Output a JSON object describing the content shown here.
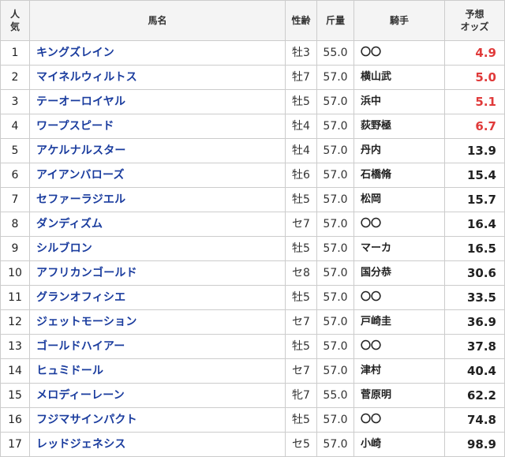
{
  "headers": {
    "rank_line1": "人",
    "rank_line2": "気",
    "name": "馬名",
    "sex_age": "性齢",
    "weight": "斤量",
    "jockey": "騎手",
    "odds_line1": "予想",
    "odds_line2": "オッズ"
  },
  "colors": {
    "horse_name": "#1a3c9e",
    "favorite_odds": "#e03a3a",
    "header_bg": "#f4f4f4"
  },
  "rows": [
    {
      "rank": "1",
      "name": "キングズレイン",
      "sex_age": "牡3",
      "weight": "55.0",
      "jockey": "〇〇",
      "odds": "4.9",
      "hot": true
    },
    {
      "rank": "2",
      "name": "マイネルウィルトス",
      "sex_age": "牡7",
      "weight": "57.0",
      "jockey": "横山武",
      "odds": "5.0",
      "hot": true
    },
    {
      "rank": "3",
      "name": "テーオーロイヤル",
      "sex_age": "牡5",
      "weight": "57.0",
      "jockey": "浜中",
      "odds": "5.1",
      "hot": true
    },
    {
      "rank": "4",
      "name": "ワープスピード",
      "sex_age": "牡4",
      "weight": "57.0",
      "jockey": "荻野極",
      "odds": "6.7",
      "hot": true
    },
    {
      "rank": "5",
      "name": "アケルナルスター",
      "sex_age": "牡4",
      "weight": "57.0",
      "jockey": "丹内",
      "odds": "13.9",
      "hot": false
    },
    {
      "rank": "6",
      "name": "アイアンバローズ",
      "sex_age": "牡6",
      "weight": "57.0",
      "jockey": "石橋脩",
      "odds": "15.4",
      "hot": false
    },
    {
      "rank": "7",
      "name": "セファーラジエル",
      "sex_age": "牡5",
      "weight": "57.0",
      "jockey": "松岡",
      "odds": "15.7",
      "hot": false
    },
    {
      "rank": "8",
      "name": "ダンディズム",
      "sex_age": "セ7",
      "weight": "57.0",
      "jockey": "〇〇",
      "odds": "16.4",
      "hot": false
    },
    {
      "rank": "9",
      "name": "シルブロン",
      "sex_age": "牡5",
      "weight": "57.0",
      "jockey": "マーカ",
      "odds": "16.5",
      "hot": false
    },
    {
      "rank": "10",
      "name": "アフリカンゴールド",
      "sex_age": "セ8",
      "weight": "57.0",
      "jockey": "国分恭",
      "odds": "30.6",
      "hot": false
    },
    {
      "rank": "11",
      "name": "グランオフィシエ",
      "sex_age": "牡5",
      "weight": "57.0",
      "jockey": "〇〇",
      "odds": "33.5",
      "hot": false
    },
    {
      "rank": "12",
      "name": "ジェットモーション",
      "sex_age": "セ7",
      "weight": "57.0",
      "jockey": "戸崎圭",
      "odds": "36.9",
      "hot": false
    },
    {
      "rank": "13",
      "name": "ゴールドハイアー",
      "sex_age": "牡5",
      "weight": "57.0",
      "jockey": "〇〇",
      "odds": "37.8",
      "hot": false
    },
    {
      "rank": "14",
      "name": "ヒュミドール",
      "sex_age": "セ7",
      "weight": "57.0",
      "jockey": "津村",
      "odds": "40.4",
      "hot": false
    },
    {
      "rank": "15",
      "name": "メロディーレーン",
      "sex_age": "牝7",
      "weight": "55.0",
      "jockey": "菅原明",
      "odds": "62.2",
      "hot": false
    },
    {
      "rank": "16",
      "name": "フジマサインパクト",
      "sex_age": "牡5",
      "weight": "57.0",
      "jockey": "〇〇",
      "odds": "74.8",
      "hot": false
    },
    {
      "rank": "17",
      "name": "レッドジェネシス",
      "sex_age": "セ5",
      "weight": "57.0",
      "jockey": "小崎",
      "odds": "98.9",
      "hot": false
    }
  ]
}
